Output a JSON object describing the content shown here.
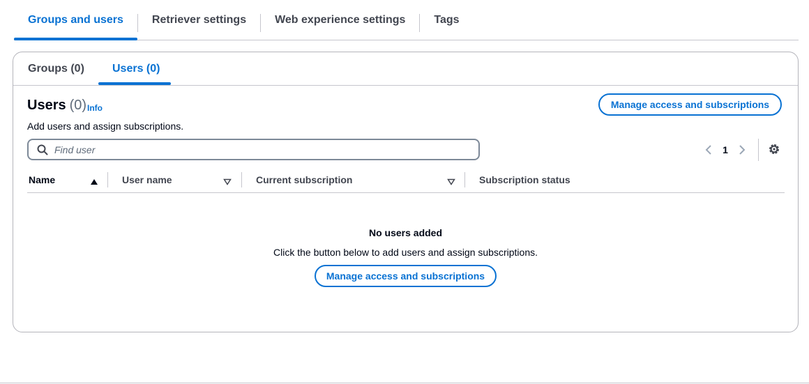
{
  "top_tabs": [
    {
      "label": "Groups and users",
      "active": true
    },
    {
      "label": "Retriever settings",
      "active": false
    },
    {
      "label": "Web experience settings",
      "active": false
    },
    {
      "label": "Tags",
      "active": false
    }
  ],
  "inner_tabs": {
    "groups": "Groups (0)",
    "users": "Users (0)"
  },
  "users_panel": {
    "title": "Users",
    "count": "(0)",
    "info": "Info",
    "description": "Add users and assign subscriptions.",
    "manage_button": "Manage access and subscriptions"
  },
  "search": {
    "placeholder": "Find user",
    "value": ""
  },
  "pagination": {
    "current_page": "1"
  },
  "table": {
    "columns": [
      "Name",
      "User name",
      "Current subscription",
      "Subscription status"
    ]
  },
  "empty_state": {
    "title": "No users added",
    "description": "Click the button below to add users and assign subscriptions.",
    "button": "Manage access and subscriptions"
  },
  "colors": {
    "accent": "#0972d3",
    "text": "#000716",
    "border": "#c6c6cd"
  },
  "icons": [
    "search-icon",
    "chevron-left-icon",
    "chevron-right-icon",
    "gear-icon",
    "sort-ascending-icon",
    "sort-descending-icon"
  ]
}
